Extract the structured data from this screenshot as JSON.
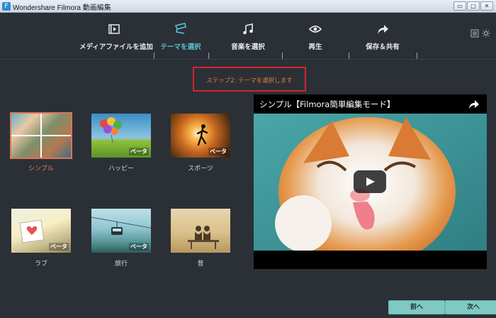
{
  "window": {
    "title": "Wondershare Filmora 動画編集"
  },
  "nav": {
    "items": [
      {
        "label": "メディアファイルを追加",
        "icon": "media-add-icon"
      },
      {
        "label": "テーマを選択",
        "icon": "theme-icon",
        "active": true
      },
      {
        "label": "音楽を選択",
        "icon": "music-note-icon"
      },
      {
        "label": "再生",
        "icon": "eye-icon"
      },
      {
        "label": "保存＆共有",
        "icon": "share-arrow-icon"
      }
    ]
  },
  "step": {
    "text": "ステップ2: テーマを選択します"
  },
  "themes": [
    {
      "label": "シンプル",
      "badge": "",
      "selected": true
    },
    {
      "label": "ハッピー",
      "badge": "ベータ"
    },
    {
      "label": "スポーツ",
      "badge": "ベータ"
    },
    {
      "label": "ラブ",
      "badge": "ベータ"
    },
    {
      "label": "旅行",
      "badge": "ベータ"
    },
    {
      "label": "昔",
      "badge": ""
    }
  ],
  "preview": {
    "title": "シンプル【Filmora簡単編集モード】"
  },
  "buttons": {
    "prev": "前へ",
    "next": "次へ"
  },
  "colors": {
    "accent": "#59c3d2",
    "selected": "#e0735c",
    "highlight_box": "#d4232a",
    "button": "#7fc9c2"
  }
}
